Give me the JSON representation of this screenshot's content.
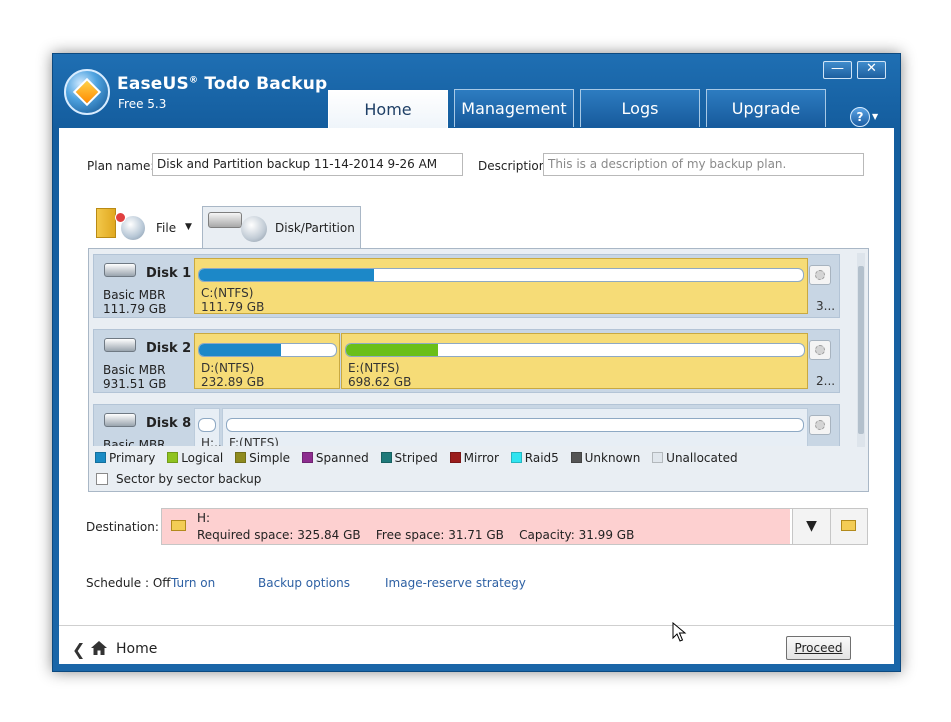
{
  "app": {
    "brand": "EaseUS",
    "registered": "®",
    "product": "Todo Backup",
    "version": "Free 5.3",
    "minimize_symbol": "—",
    "close_symbol": "✕"
  },
  "tabs": [
    {
      "label": "Home",
      "active": true
    },
    {
      "label": "Management",
      "active": false
    },
    {
      "label": "Logs",
      "active": false
    },
    {
      "label": "Upgrade",
      "active": false
    }
  ],
  "help": {
    "symbol": "?",
    "caret": "▼"
  },
  "plan": {
    "name_label": "Plan name:",
    "name_value": "Disk and Partition backup 11-14-2014 9-26 AM",
    "desc_label": "Description:",
    "desc_placeholder": "This is a description of my backup plan."
  },
  "source_tabs": {
    "file_label": "File",
    "file_caret": "▼",
    "disk_label": "Disk/Partition"
  },
  "disks": [
    {
      "name": "Disk 1",
      "type": "Basic MBR",
      "size": "111.79 GB",
      "partitions": [
        {
          "name": "C:(NTFS)",
          "size": "111.79 GB",
          "used_fraction": 0.29,
          "fill_color": "#1c88c8",
          "selected": true
        }
      ],
      "extra_text": "3..."
    },
    {
      "name": "Disk 2",
      "type": "Basic MBR",
      "size": "931.51 GB",
      "partitions": [
        {
          "name": "D:(NTFS)",
          "size": "232.89 GB",
          "used_fraction": 0.6,
          "fill_color": "#1c88c8",
          "selected": true
        },
        {
          "name": "E:(NTFS)",
          "size": "698.62 GB",
          "used_fraction": 0.2,
          "fill_color": "#6abf1a",
          "selected": true
        }
      ],
      "extra_text": "2..."
    },
    {
      "name": "Disk 8",
      "type": "Basic MBR",
      "size": "",
      "partitions": [
        {
          "name": "H:..",
          "size": "",
          "used_fraction": 0,
          "fill_color": "#1c88c8",
          "selected": false
        },
        {
          "name": "F:(NTFS)",
          "size": "",
          "used_fraction": 0,
          "fill_color": "#1c88c8",
          "selected": false
        }
      ],
      "extra_text": ""
    }
  ],
  "legend": [
    {
      "label": "Primary",
      "color": "#1a8bc4"
    },
    {
      "label": "Logical",
      "color": "#8fc31f"
    },
    {
      "label": "Simple",
      "color": "#8e8a1e"
    },
    {
      "label": "Spanned",
      "color": "#8d2d8f"
    },
    {
      "label": "Striped",
      "color": "#1f7a7a"
    },
    {
      "label": "Mirror",
      "color": "#9a1c1c"
    },
    {
      "label": "Raid5",
      "color": "#2fe4f0"
    },
    {
      "label": "Unknown",
      "color": "#555555"
    },
    {
      "label": "Unallocated",
      "color": "#e0e6ec"
    }
  ],
  "sector_backup": {
    "label": "Sector by sector backup",
    "checked": false
  },
  "destination": {
    "label": "Destination:",
    "name": "H:",
    "info": "Required space: 325.84 GB    Free space: 31.71 GB    Capacity: 31.99 GB",
    "dropdown_symbol": "▼"
  },
  "options": {
    "schedule_label": "Schedule : Off",
    "turn_on": "Turn on",
    "backup_options": "Backup options",
    "image_reserve": "Image-reserve strategy"
  },
  "footer": {
    "back_symbol": "❮",
    "home_label": "Home",
    "proceed_label": "Proceed"
  }
}
